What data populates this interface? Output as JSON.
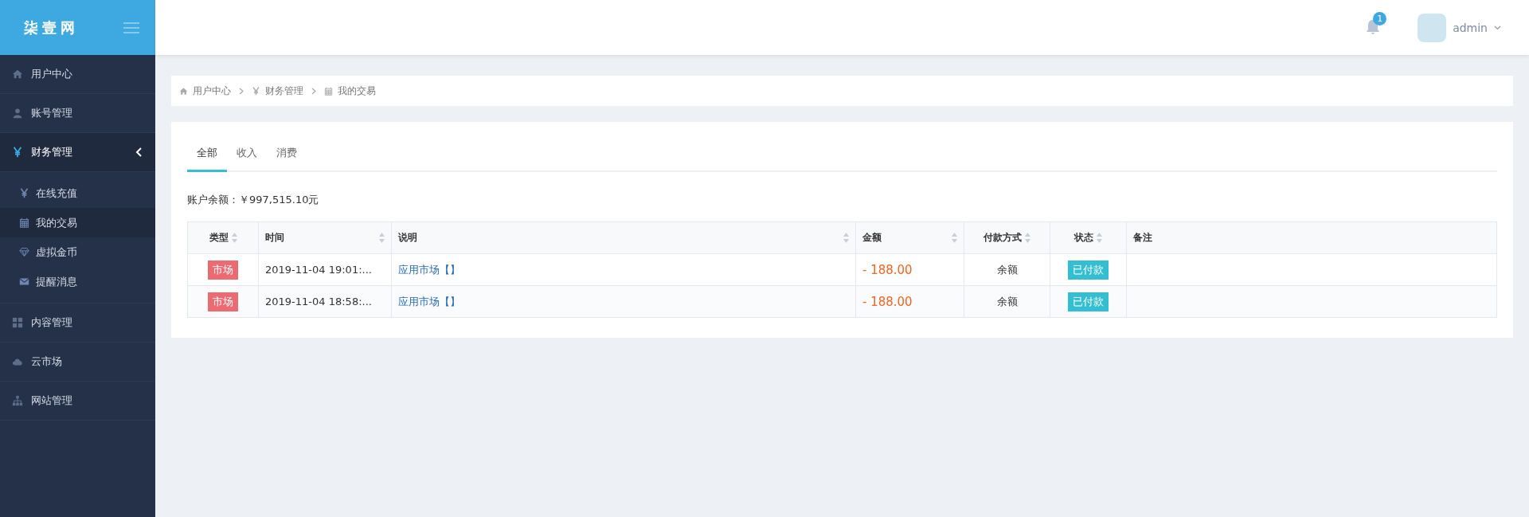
{
  "sidebar": {
    "logo": "柒壹网",
    "items": [
      {
        "label": "用户中心",
        "expanded": false
      },
      {
        "label": "账号管理",
        "expanded": false
      },
      {
        "label": "财务管理",
        "expanded": true,
        "children": [
          {
            "label": "在线充值",
            "selected": false
          },
          {
            "label": "我的交易",
            "selected": true
          },
          {
            "label": "虚拟金币",
            "selected": false
          },
          {
            "label": "提醒消息",
            "selected": false
          }
        ]
      },
      {
        "label": "内容管理",
        "expanded": false
      },
      {
        "label": "云市场",
        "expanded": false
      },
      {
        "label": "网站管理",
        "expanded": false
      }
    ]
  },
  "header": {
    "notification_count": "1",
    "user": "admin"
  },
  "breadcrumb": [
    "用户中心",
    "财务管理",
    "我的交易"
  ],
  "tabs": [
    {
      "label": "全部",
      "selected": true
    },
    {
      "label": "收入",
      "selected": false
    },
    {
      "label": "消费",
      "selected": false
    }
  ],
  "balance": "账户余额：￥997,515.10元",
  "table": {
    "columns": [
      {
        "label": "类型",
        "sortable": true
      },
      {
        "label": "时间",
        "sortable": true
      },
      {
        "label": "说明",
        "sortable": true
      },
      {
        "label": "金额",
        "sortable": true
      },
      {
        "label": "付款方式",
        "sortable": true
      },
      {
        "label": "状态",
        "sortable": true
      },
      {
        "label": "备注",
        "sortable": false
      }
    ],
    "rows": [
      {
        "type": "市场",
        "time": "2019-11-04 19:01:...",
        "description": "应用市场【】",
        "amount": "- 188.00",
        "payment": "余额",
        "status": "已付款"
      },
      {
        "type": "市场",
        "time": "2019-11-04 18:58:...",
        "description": "应用市场【】",
        "amount": "- 188.00",
        "payment": "余额",
        "status": "已付款"
      }
    ]
  }
}
